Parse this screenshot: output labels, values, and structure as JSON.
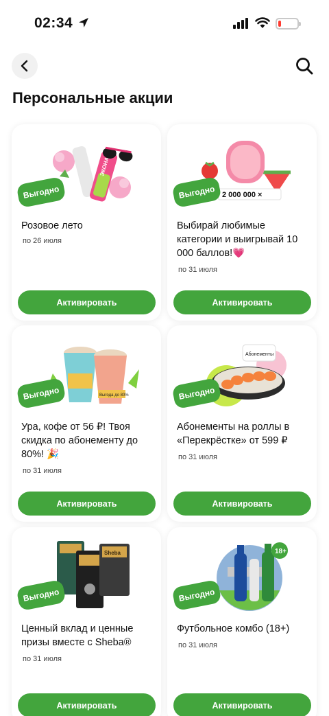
{
  "status_bar": {
    "time": "02:34",
    "battery_level": 0.15
  },
  "header": {
    "title": "Персональные акции"
  },
  "offers": [
    {
      "badge": "Выгодно",
      "title": "Розовое лето",
      "date": "по 26 июля",
      "button": "Активировать",
      "image_text": [
        "ЭКОНАД"
      ]
    },
    {
      "badge": "Выгодно",
      "title": "Выбирай любимые категории и выигрывай 10 000 баллов!💗",
      "date": "по 31 июля",
      "button": "Активировать",
      "image_text": [
        "2 000 000 ×"
      ]
    },
    {
      "badge": "Выгодно",
      "title": "Ура, кофе от 56 ₽! Твоя скидка по абонементу до 80%! 🎉",
      "date": "по 31 июля",
      "button": "Активировать",
      "image_text": [
        "Выгода до 80%"
      ]
    },
    {
      "badge": "Выгодно",
      "title": "Абонементы на роллы в «Перекрёстке» от 599 ₽",
      "date": "по 31 июля",
      "button": "Активировать",
      "image_text": [
        "Абонементы"
      ]
    },
    {
      "badge": "Выгодно",
      "title": "Ценный вклад и ценные призы вместе с Sheba®",
      "date": "по 31 июля",
      "button": "Активировать",
      "image_text": [
        "Sheba"
      ]
    },
    {
      "badge": "Выгодно",
      "title": "Футбольное комбо (18+)",
      "date": "по 31 июля",
      "button": "Активировать",
      "image_text": [
        "18+"
      ]
    }
  ],
  "colors": {
    "accent_green": "#43a53d",
    "battery_red": "#ff3b30"
  },
  "icons": {
    "back": "chevron-left-icon",
    "search": "search-icon"
  }
}
